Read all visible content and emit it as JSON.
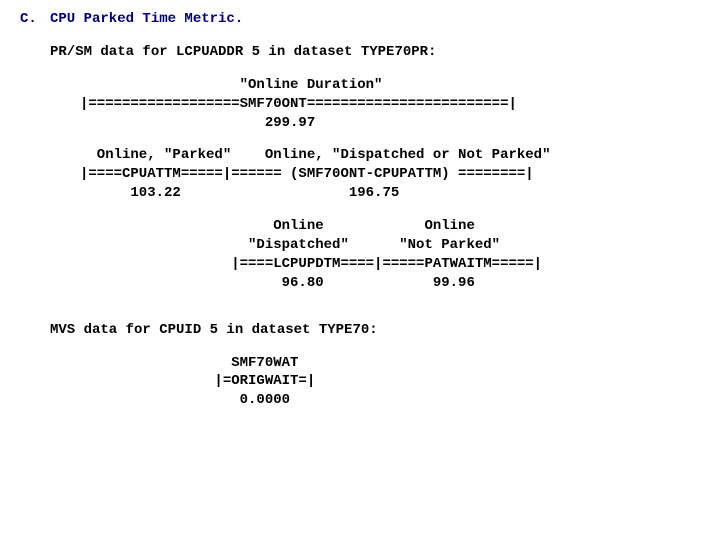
{
  "section": {
    "marker": "C.",
    "title": "CPU Parked Time Metric."
  },
  "prsm_heading": "PR/SM data for LCPUADDR 5 in dataset TYPE70PR:",
  "diag1": {
    "l1": "                   \"Online Duration\"",
    "l2": "|==================SMF70ONT========================|",
    "l3": "                      299.97"
  },
  "diag2": {
    "l1": "  Online, \"Parked\"    Online, \"Dispatched or Not Parked\"",
    "l2": "|====CPUATTM=====|====== (SMF70ONT-CPUPATTM) ========|",
    "l3": "      103.22                    196.75"
  },
  "diag3": {
    "l1": "                       Online            Online",
    "l2": "                    \"Dispatched\"      \"Not Parked\"",
    "l3": "                  |====LCPUPDTM====|=====PATWAITM=====|",
    "l4": "                        96.80             99.96"
  },
  "mvs_heading": "MVS data for CPUID 5 in dataset TYPE70:",
  "diag4": {
    "l1": "                  SMF70WAT",
    "l2": "                |=ORIGWAIT=|",
    "l3": "                   0.0000"
  },
  "chart_data": {
    "type": "table",
    "title": "CPU Parked Time Metric — PR/SM and MVS breakdown for LCPUADDR/CPUID 5",
    "metrics": [
      {
        "name": "SMF70ONT (Online Duration)",
        "value": 299.97
      },
      {
        "name": "CPUATTM (Online, Parked)",
        "value": 103.22
      },
      {
        "name": "SMF70ONT - CPUPATTM (Online, Dispatched or Not Parked)",
        "value": 196.75
      },
      {
        "name": "LCPUPDTM (Online, Dispatched)",
        "value": 96.8
      },
      {
        "name": "PATWAITM (Online, Not Parked)",
        "value": 99.96
      },
      {
        "name": "SMF70WAT / ORIGWAIT",
        "value": 0.0
      }
    ]
  }
}
